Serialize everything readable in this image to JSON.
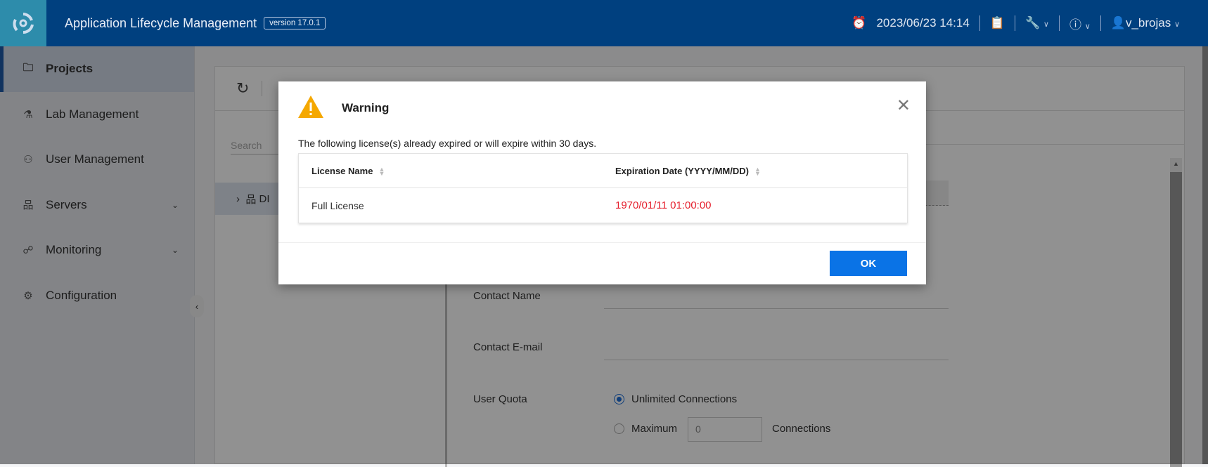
{
  "header": {
    "app_title": "Application Lifecycle Management",
    "version": "version 17.0.1",
    "datetime": "2023/06/23 14:14",
    "user": "v_brojas"
  },
  "sidebar": {
    "items": [
      {
        "label": "Projects",
        "icon": "folder-icon"
      },
      {
        "label": "Lab Management",
        "icon": "lab-icon"
      },
      {
        "label": "User Management",
        "icon": "user-settings-icon"
      },
      {
        "label": "Servers",
        "icon": "servers-icon"
      },
      {
        "label": "Monitoring",
        "icon": "monitoring-icon"
      },
      {
        "label": "Configuration",
        "icon": "gear-icon"
      }
    ]
  },
  "main": {
    "search_placeholder": "Search",
    "tree_item": "DI",
    "form": {
      "contact_name": "Contact Name",
      "contact_email": "Contact E-mail",
      "user_quota": "User Quota",
      "unlimited": "Unlimited Connections",
      "maximum": "Maximum",
      "max_value": "0",
      "connections": "Connections"
    }
  },
  "dialog": {
    "title": "Warning",
    "message": "The following license(s) already expired or will expire within 30 days.",
    "columns": [
      "License Name",
      "Expiration Date (YYYY/MM/DD)"
    ],
    "rows": [
      {
        "name": "Full License",
        "date": "1970/01/11 01:00:00"
      }
    ],
    "ok_label": "OK",
    "expired_color": "#e5202e"
  }
}
